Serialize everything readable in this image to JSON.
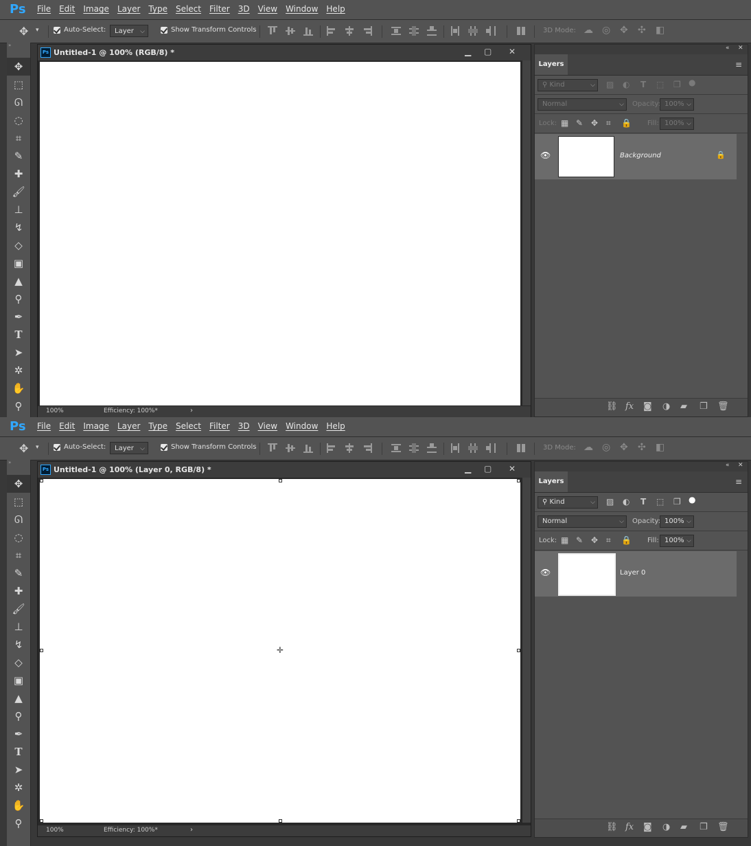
{
  "menubar": {
    "logo": "Ps",
    "items": [
      "File",
      "Edit",
      "Image",
      "Layer",
      "Type",
      "Select",
      "Filter",
      "3D",
      "View",
      "Window",
      "Help"
    ]
  },
  "options": {
    "auto_select_label": "Auto-Select:",
    "auto_select_value": "Layer",
    "show_transform_label": "Show Transform Controls",
    "mode3d_label": "3D Mode:"
  },
  "tools": [
    "move-tool",
    "marquee-tool",
    "lasso-tool",
    "quick-select-tool",
    "crop-tool",
    "eyedropper-tool",
    "healing-brush-tool",
    "brush-tool",
    "clone-stamp-tool",
    "history-brush-tool",
    "eraser-tool",
    "gradient-tool",
    "blur-tool",
    "dodge-tool",
    "pen-tool",
    "type-tool",
    "path-select-tool",
    "custom-shape-tool",
    "hand-tool",
    "zoom-tool"
  ],
  "shot1": {
    "doc_title": "Untitled-1 @ 100% (RGB/8) *",
    "zoom": "100%",
    "efficiency": "Efficiency: 100%*",
    "layers": {
      "tab": "Layers",
      "filter_kind": "Kind",
      "blend_mode": "Normal",
      "opacity_label": "Opacity:",
      "opacity_value": "100%",
      "lock_label": "Lock:",
      "fill_label": "Fill:",
      "fill_value": "100%",
      "layer_name": "Background"
    }
  },
  "shot2": {
    "doc_title": "Untitled-1 @ 100% (Layer 0, RGB/8) *",
    "zoom": "100%",
    "efficiency": "Efficiency: 100%*",
    "layers": {
      "tab": "Layers",
      "filter_kind": "Kind",
      "blend_mode": "Normal",
      "opacity_label": "Opacity:",
      "opacity_value": "100%",
      "lock_label": "Lock:",
      "fill_label": "Fill:",
      "fill_value": "100%",
      "layer_name": "Layer 0"
    }
  },
  "colors": {
    "accent": "#31a8ff",
    "ui_dark": "#535353",
    "canvas": "#ffffff"
  }
}
